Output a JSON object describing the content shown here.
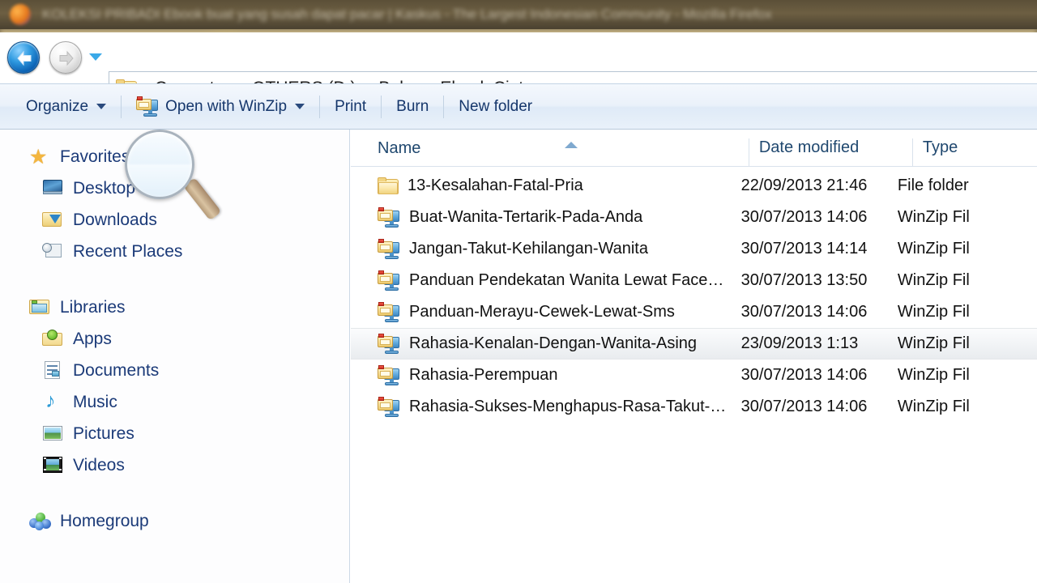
{
  "background_window": {
    "title": "KOLEKSI PRIBADI Ebook buat yang susah dapat pacar | Kaskus - The Largest Indonesian Community - Mozilla Firefox",
    "app_icon": "firefox-icon"
  },
  "address_bar": {
    "back_label": "Back",
    "forward_label": "Forward",
    "recent_pages_label": "Recent Pages",
    "folder_icon": "folder-icon",
    "breadcrumbs": [
      "Computer",
      "OTHERS (D:)",
      "Buku",
      "Ebook Cinta"
    ],
    "separator": "▸"
  },
  "toolbar": {
    "items": [
      {
        "label": "Organize",
        "has_caret": true,
        "icon": null
      },
      {
        "label": "Open with WinZip",
        "has_caret": true,
        "icon": "winzip-icon"
      },
      {
        "label": "Print",
        "has_caret": false,
        "icon": null
      },
      {
        "label": "Burn",
        "has_caret": false,
        "icon": null
      },
      {
        "label": "New folder",
        "has_caret": false,
        "icon": null
      }
    ]
  },
  "navigation_pane": {
    "groups": [
      {
        "header": {
          "label": "Favorites",
          "icon": "star-icon"
        },
        "items": [
          {
            "label": "Desktop",
            "icon": "desktop-icon"
          },
          {
            "label": "Downloads",
            "icon": "downloads-icon"
          },
          {
            "label": "Recent Places",
            "icon": "recent-places-icon"
          }
        ]
      },
      {
        "header": {
          "label": "Libraries",
          "icon": "libraries-icon"
        },
        "items": [
          {
            "label": "Apps",
            "icon": "apps-icon"
          },
          {
            "label": "Documents",
            "icon": "documents-icon"
          },
          {
            "label": "Music",
            "icon": "music-icon"
          },
          {
            "label": "Pictures",
            "icon": "pictures-icon"
          },
          {
            "label": "Videos",
            "icon": "videos-icon"
          }
        ]
      },
      {
        "header": {
          "label": "Homegroup",
          "icon": "homegroup-icon"
        },
        "items": []
      }
    ]
  },
  "file_list": {
    "columns": [
      {
        "key": "name",
        "label": "Name",
        "sorted": "ascending"
      },
      {
        "key": "date",
        "label": "Date modified",
        "sorted": null
      },
      {
        "key": "type",
        "label": "Type",
        "sorted": null
      }
    ],
    "rows": [
      {
        "name": "13-Kesalahan-Fatal-Pria",
        "date": "22/09/2013 21:46",
        "type": "File folder",
        "icon": "folder-icon",
        "hovered": false
      },
      {
        "name": "Buat-Wanita-Tertarik-Pada-Anda",
        "date": "30/07/2013 14:06",
        "type": "WinZip Fil",
        "icon": "winzip-file-icon",
        "hovered": false
      },
      {
        "name": "Jangan-Takut-Kehilangan-Wanita",
        "date": "30/07/2013 14:14",
        "type": "WinZip Fil",
        "icon": "winzip-file-icon",
        "hovered": false
      },
      {
        "name": "Panduan Pendekatan Wanita Lewat Face…",
        "date": "30/07/2013 13:50",
        "type": "WinZip Fil",
        "icon": "winzip-file-icon",
        "hovered": false
      },
      {
        "name": "Panduan-Merayu-Cewek-Lewat-Sms",
        "date": "30/07/2013 14:06",
        "type": "WinZip Fil",
        "icon": "winzip-file-icon",
        "hovered": false
      },
      {
        "name": "Rahasia-Kenalan-Dengan-Wanita-Asing",
        "date": "23/09/2013 1:13",
        "type": "WinZip Fil",
        "icon": "winzip-file-icon",
        "hovered": true
      },
      {
        "name": "Rahasia-Perempuan",
        "date": "30/07/2013 14:06",
        "type": "WinZip Fil",
        "icon": "winzip-file-icon",
        "hovered": false
      },
      {
        "name": "Rahasia-Sukses-Menghapus-Rasa-Takut-…",
        "date": "30/07/2013 14:06",
        "type": "WinZip Fil",
        "icon": "winzip-file-icon",
        "hovered": false
      }
    ]
  },
  "cursor": {
    "type": "magnifier-cursor"
  },
  "colors": {
    "toolbar_text": "#15366b",
    "nav_text": "#1b3a78",
    "column_header_text": "#20486f",
    "row_text": "#111111",
    "accent_blue": "#2e86c8",
    "folder_yellow": "#f2d483"
  }
}
